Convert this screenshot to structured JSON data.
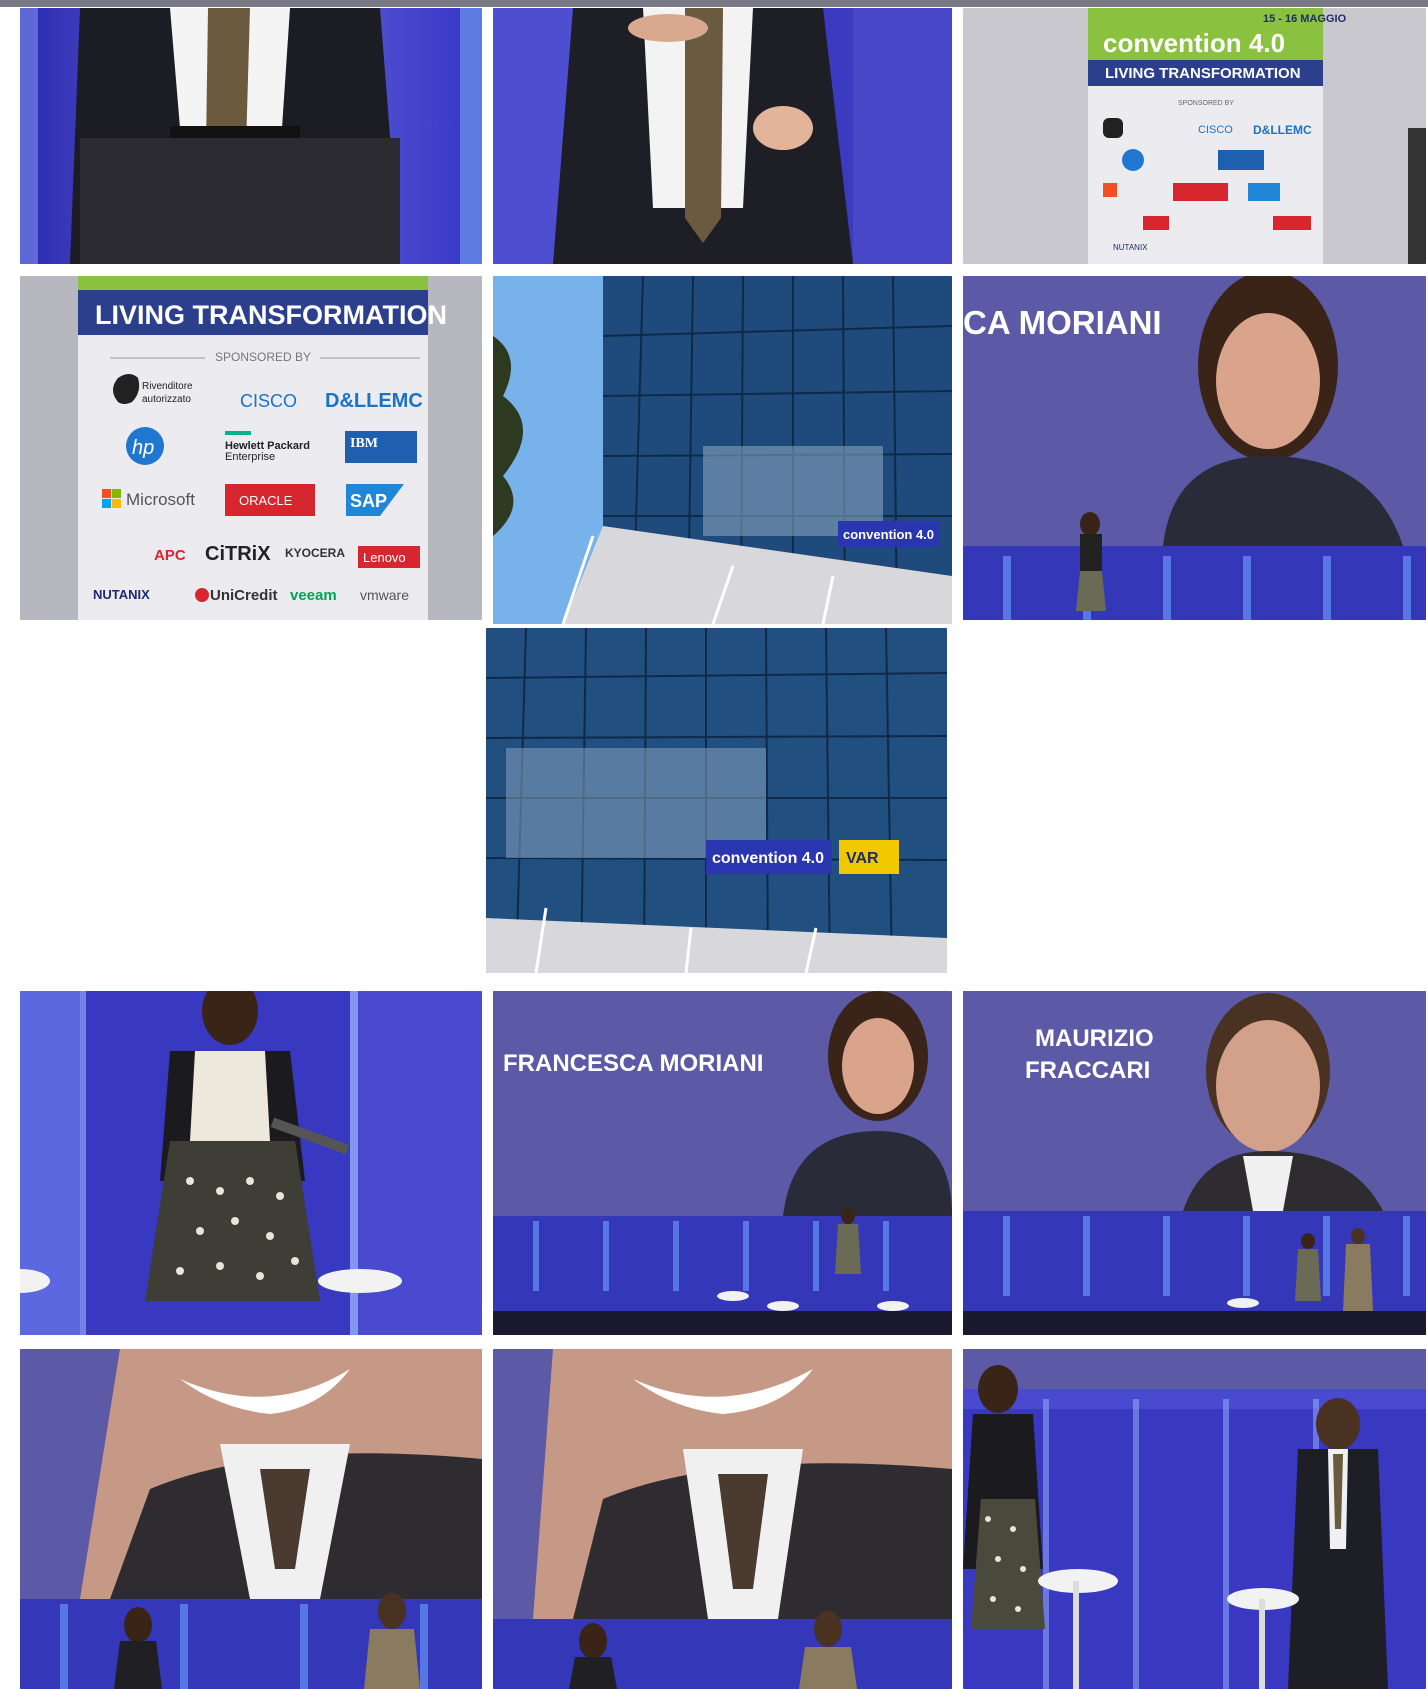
{
  "gallery": {
    "banner": {
      "date": "15 - 16 MAGGIO",
      "brand": "convention 4.0",
      "tagline": "LIVING TRANSFORMATION",
      "sponsored_by": "SPONSORED BY",
      "sponsors": {
        "apple_line1": "Rivenditore",
        "apple_line2": "autorizzato",
        "cisco": "CISCO",
        "dellemc": "D&LLEMC",
        "hp": "hp",
        "hpe_line1": "Hewlett Packard",
        "hpe_line2": "Enterprise",
        "ibm": "IBM",
        "microsoft": "Microsoft",
        "oracle": "ORACLE",
        "sap": "SAP",
        "apc": "APC",
        "citrix": "CiTRiX",
        "kyocera": "KYOCERA",
        "lenovo": "Lenovo",
        "nutanix": "NUTANIX",
        "unicredit": "UniCredit",
        "veeam": "veeam",
        "vmware": "vmware"
      }
    },
    "building_sign": "convention 4.0",
    "building_sign_partner": "VAR",
    "speakers": {
      "screen_name_1": "FRANCESCA MORIANI",
      "screen_name_1_partial": "CA MORIANI",
      "screen_name_2_line1": "MAURIZIO",
      "screen_name_2_line2": "FRACCARI"
    },
    "colors": {
      "stage_blue": "#3f3fc0",
      "screen_purple": "#5c5aa6",
      "banner_green": "#8ac240",
      "banner_navy": "#2b3f8c",
      "glass_blue": "#2b5f8f"
    }
  }
}
